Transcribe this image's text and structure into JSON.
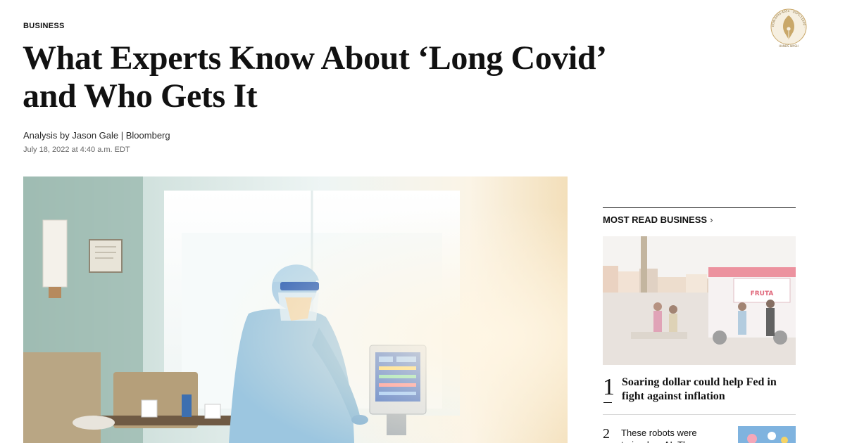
{
  "article": {
    "section": "BUSINESS",
    "headline": "What Experts Know About ‘Long Covid’ and Who Gets It",
    "byline_prefix": "Analysis by ",
    "author": "Jason Gale",
    "separator": " | ",
    "source": "Bloomberg",
    "date": "July 18, 2022 at 4:40 a.m. EDT"
  },
  "badge": {
    "ring_text": "ISSN:0043-4051 · USPS:11030 · ",
    "caption": "HANDS WASH"
  },
  "rail": {
    "heading": "MOST READ BUSINESS",
    "chevron": "›",
    "items": [
      {
        "rank": "1",
        "title": "Soaring dollar could help Fed in fight against inflation"
      },
      {
        "rank": "2",
        "title": "These robots were trained on AI. They"
      }
    ],
    "truck_text": "FRUTA"
  },
  "colors": {
    "text": "#111111",
    "muted": "#666666",
    "rule": "#d9d9d9",
    "badge_gold": "#c9a86a",
    "ppe_blue": "#9cc6e0"
  },
  "icons": {
    "badge": "pen-nib-seal-icon",
    "chevron": "chevron-right-icon"
  }
}
